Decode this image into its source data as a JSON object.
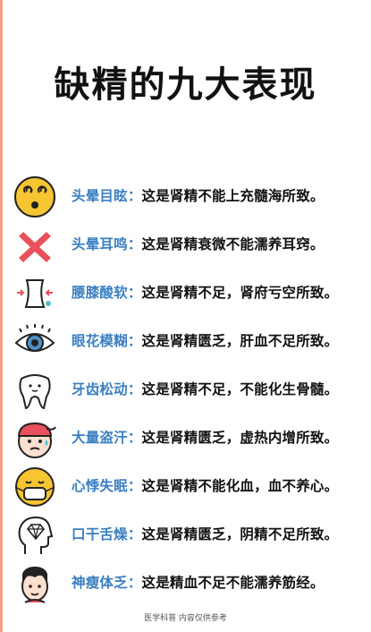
{
  "title": "缺精的九大表现",
  "accent_color": "#3b7fc0",
  "items": [
    {
      "term": "头晕目眩",
      "desc": "这是肾精不能上充髓海所致。",
      "icon": "dizzy-face-icon"
    },
    {
      "term": "头晕耳鸣",
      "desc": "这是肾精衰微不能濡养耳窍。",
      "icon": "red-x-icon"
    },
    {
      "term": "腰膝酸软",
      "desc": "这是肾精不足，肾府亏空所致。",
      "icon": "waist-icon"
    },
    {
      "term": "眼花模糊",
      "desc": "这是肾精匮乏，肝血不足所致。",
      "icon": "eye-icon"
    },
    {
      "term": "牙齿松动",
      "desc": "这是肾精不足，不能化生骨髓。",
      "icon": "tooth-icon"
    },
    {
      "term": "大量盗汗",
      "desc": "这是肾精匮乏，虚热内增所致。",
      "icon": "sweating-boy-icon"
    },
    {
      "term": "心悸失眠",
      "desc": "这是肾精不能化血，血不养心。",
      "icon": "masked-face-icon"
    },
    {
      "term": "口干舌燥",
      "desc": "这是肾精匮乏，阴精不足所致。",
      "icon": "head-diamond-icon"
    },
    {
      "term": "神瘦体乏",
      "desc": "这是精血不足不能濡养筋经。",
      "icon": "man-face-icon"
    }
  ],
  "colon": "：",
  "footer": "医学科普 内容仅供参考"
}
